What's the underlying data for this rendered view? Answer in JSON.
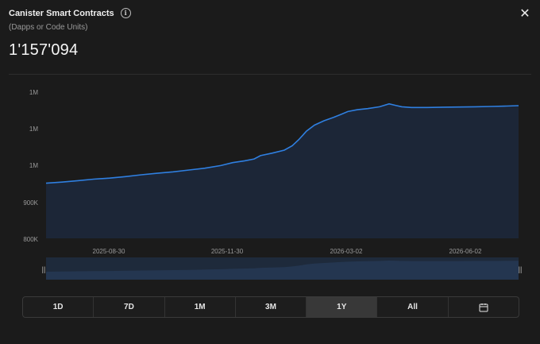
{
  "header": {
    "title": "Canister Smart Contracts",
    "subtitle": "(Dapps or Code Units)",
    "value": "1'157'094",
    "info_icon": "ⓘ",
    "close_icon": "✕"
  },
  "range_tabs": [
    {
      "label": "1D",
      "active": false
    },
    {
      "label": "7D",
      "active": false
    },
    {
      "label": "1M",
      "active": false
    },
    {
      "label": "3M",
      "active": false
    },
    {
      "label": "1Y",
      "active": true
    },
    {
      "label": "All",
      "active": false
    },
    {
      "label": "",
      "icon": "calendar-icon",
      "active": false
    }
  ],
  "colors": {
    "line": "#2f7fe0",
    "area": "#1c2637",
    "background": "#1b1b1b"
  },
  "chart_data": {
    "type": "area",
    "y_tick_labels": [
      "1M",
      "1M",
      "1M",
      "900K",
      "800K"
    ],
    "x_tick_labels": [
      "2025-08-30",
      "2025-11-30",
      "2026-03-02",
      "2026-06-02"
    ],
    "ylim": [
      800000,
      1200000
    ],
    "grid": false,
    "series": [
      {
        "values": [
          [
            0,
            950000
          ],
          [
            20,
            953000
          ],
          [
            40,
            957000
          ],
          [
            60,
            961000
          ],
          [
            80,
            964000
          ],
          [
            100,
            968000
          ],
          [
            120,
            973000
          ],
          [
            140,
            977000
          ],
          [
            160,
            981000
          ],
          [
            180,
            986000
          ],
          [
            200,
            991000
          ],
          [
            220,
            998000
          ],
          [
            235,
            1006000
          ],
          [
            250,
            1011000
          ],
          [
            262,
            1016000
          ],
          [
            270,
            1025000
          ],
          [
            285,
            1032000
          ],
          [
            300,
            1040000
          ],
          [
            310,
            1052000
          ],
          [
            318,
            1068000
          ],
          [
            328,
            1092000
          ],
          [
            338,
            1108000
          ],
          [
            350,
            1120000
          ],
          [
            362,
            1129000
          ],
          [
            372,
            1138000
          ],
          [
            380,
            1145000
          ],
          [
            392,
            1150000
          ],
          [
            405,
            1153000
          ],
          [
            420,
            1158000
          ],
          [
            432,
            1166000
          ],
          [
            440,
            1162000
          ],
          [
            448,
            1158000
          ],
          [
            460,
            1156000
          ],
          [
            480,
            1156000
          ],
          [
            500,
            1157000
          ],
          [
            520,
            1157500
          ],
          [
            540,
            1158000
          ],
          [
            560,
            1159000
          ],
          [
            580,
            1160000
          ],
          [
            595,
            1161000
          ]
        ]
      }
    ],
    "navigator_handle_left": "||",
    "navigator_handle_right": "||"
  }
}
